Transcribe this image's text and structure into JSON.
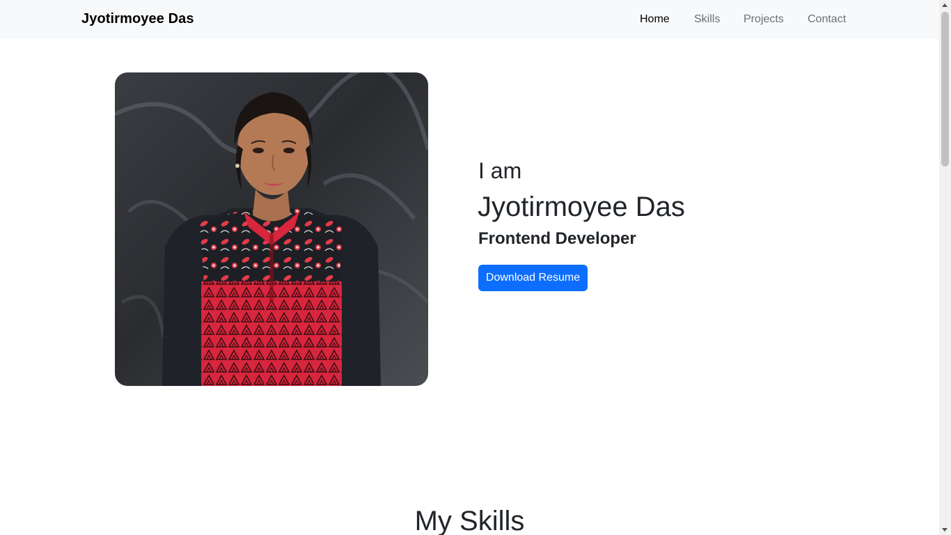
{
  "navbar": {
    "brand": "Jyotirmoyee Das",
    "links": [
      {
        "label": "Home",
        "active": true
      },
      {
        "label": "Skills",
        "active": false
      },
      {
        "label": "Projects",
        "active": false
      },
      {
        "label": "Contact",
        "active": false
      }
    ]
  },
  "hero": {
    "intro": "I am",
    "name": "Jyotirmoyee Das",
    "role": "Frontend Developer",
    "button_label": "Download Resume",
    "photo_alt": "Jyotirmoyee Das"
  },
  "skills": {
    "title": "My Skills"
  },
  "colors": {
    "accent": "#0d6efd",
    "navbar_bg": "#f8f9fa",
    "text": "#212529"
  }
}
